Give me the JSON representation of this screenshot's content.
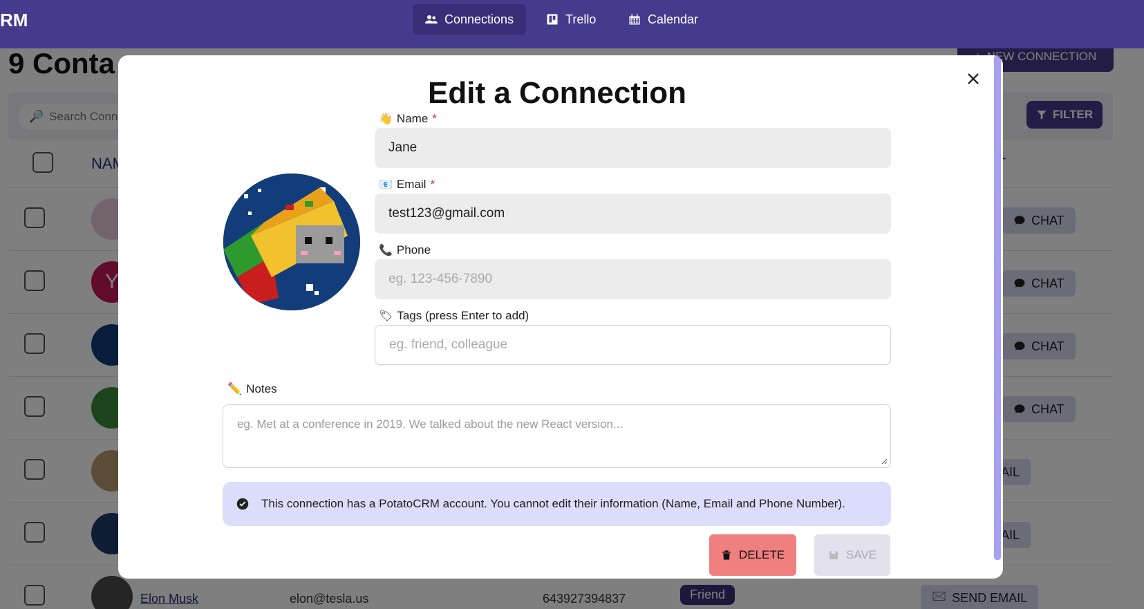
{
  "nav": {
    "brand": "RM",
    "tabs": [
      {
        "label": "Connections",
        "icon": "users-icon",
        "active": true
      },
      {
        "label": "Trello",
        "icon": "trello-icon",
        "active": false
      },
      {
        "label": "Calendar",
        "icon": "calendar-icon",
        "active": false
      }
    ]
  },
  "page": {
    "title": "9 Conta",
    "new_button": "NEW CONNECTION",
    "search_placeholder": "Search Conn",
    "filter_button": "FILTER",
    "col_name": "NAM",
    "col_action": "T",
    "rows": [
      {
        "action": "CHAT"
      },
      {
        "action": "CHAT",
        "avatar_letter": "Y"
      },
      {
        "action": "CHAT"
      },
      {
        "action": "CHAT"
      },
      {
        "action": "AIL"
      },
      {
        "action": "AIL"
      },
      {
        "name": "Elon Musk",
        "email": "elon@tesla.us",
        "phone": "643927394837",
        "tag": "Friend",
        "action": "SEND EMAIL"
      }
    ]
  },
  "modal": {
    "title": "Edit a Connection",
    "name_label": "Name",
    "name_value": "Jane",
    "email_label": "Email",
    "email_value": "test123@gmail.com",
    "phone_label": "Phone",
    "phone_placeholder": "eg. 123-456-7890",
    "tags_label": "Tags (press Enter to add)",
    "tags_placeholder": "eg. friend, colleague",
    "notes_label": "Notes",
    "notes_placeholder": "eg. Met at a conference in 2019. We talked about the new React version...",
    "info_text": "This connection has a PotatoCRM account. You cannot edit their information (Name, Email and Phone Number).",
    "delete_label": "DELETE",
    "save_label": "SAVE"
  },
  "colors": {
    "brand": "#463a8c",
    "delete": "#f07f80",
    "info_bg": "#dcdcfb"
  }
}
